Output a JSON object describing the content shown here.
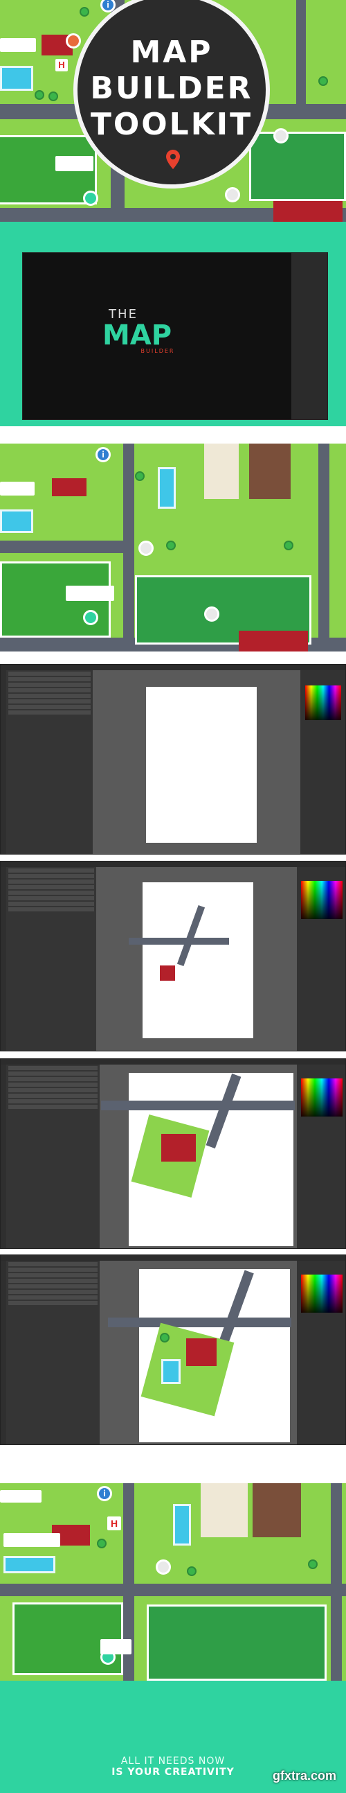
{
  "title": {
    "line1": "MAP",
    "line2": "BUILDER",
    "line3": "TOOLKIT"
  },
  "logo": {
    "the": "THE",
    "map": "MAP",
    "builder": "BUILDER"
  },
  "tagline": {
    "line1": "ALL IT NEEDS NOW",
    "line2": "IS YOUR CREATIVITY"
  },
  "watermark": "gfxtra.com",
  "map_markers": {
    "info": "i",
    "hospital": "H"
  },
  "colors": {
    "brand_green": "#2fd3a0",
    "grass": "#8cd34c",
    "road": "#5b6270",
    "roof": "#b3202a",
    "pool": "#3fc6e8",
    "dark_ui": "#3b3b3b"
  }
}
